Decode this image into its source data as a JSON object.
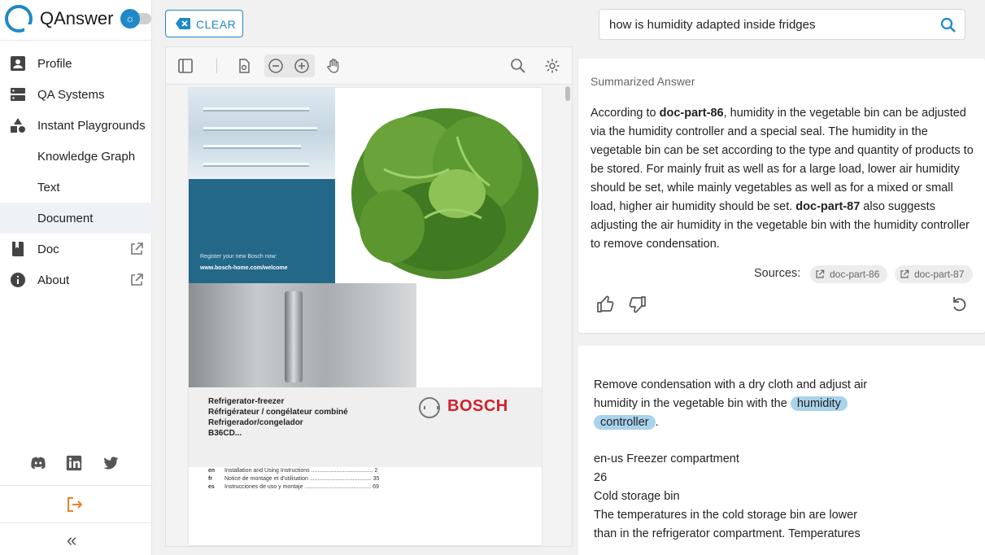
{
  "brand": {
    "name": "QAnswer"
  },
  "nav": {
    "profile": "Profile",
    "qa_systems": "QA Systems",
    "instant_playgrounds": "Instant Playgrounds",
    "knowledge_graph": "Knowledge Graph",
    "text": "Text",
    "document": "Document",
    "doc": "Doc",
    "about": "About"
  },
  "toolbar": {
    "clear_label": "CLEAR"
  },
  "search": {
    "value": "how is humidity adapted inside fridges"
  },
  "pdf": {
    "register_line1": "Register your new Bosch now:",
    "register_line2": "www.bosch-home.com/welcome",
    "model_lines": [
      "Refrigerator-freezer",
      "Réfrigérateur / congélateur combiné",
      "Refrigerador/congelador",
      "B36CD..."
    ],
    "brand_word": "BOSCH",
    "toc": [
      {
        "code": "en",
        "text": "Installation and Using Instructions ....................................... 2",
        "page": ""
      },
      {
        "code": "fr",
        "text": "Notice de montage et d'utilisation ....................................... 35",
        "page": ""
      },
      {
        "code": "es",
        "text": "Instrucciones de uso y montaje .......................................... 69",
        "page": ""
      }
    ]
  },
  "answer": {
    "title": "Summarized Answer",
    "doc_a": "doc-part-86",
    "seg_1": "According to ",
    "seg_2": ", humidity in the vegetable bin can be adjusted via the humidity controller and a special seal. The humidity in the vegetable bin can be set according to the type and quantity of products to be stored. For mainly fruit as well as for a large load, lower air humidity should be set, while mainly vegetables as well as for a mixed or small load, higher air humidity should be set. ",
    "doc_b": "doc-part-87",
    "seg_3": " also suggests adjusting the air humidity in the vegetable bin with the humidity controller to remove condensation.",
    "sources_label": "Sources:",
    "source_1": "doc-part-86",
    "source_2": "doc-part-87"
  },
  "passage": {
    "line1": "Remove condensation with a dry cloth and adjust air",
    "line2_pre": "humidity in the vegetable bin with the ",
    "hl_1": "humidity",
    "hl_2": "controller",
    "line3_post": ".",
    "line4": "en-us   Freezer compartment",
    "line5": "26",
    "line6": "Cold storage bin",
    "line7": "The temperatures in the cold storage bin are lower",
    "line8": "than in the refrigerator compartment. Temperatures"
  },
  "colors": {
    "accent": "#1e88c9",
    "logout": "#e8832a",
    "bosch_red": "#d0222c",
    "highlight": "#a9d3ec"
  }
}
